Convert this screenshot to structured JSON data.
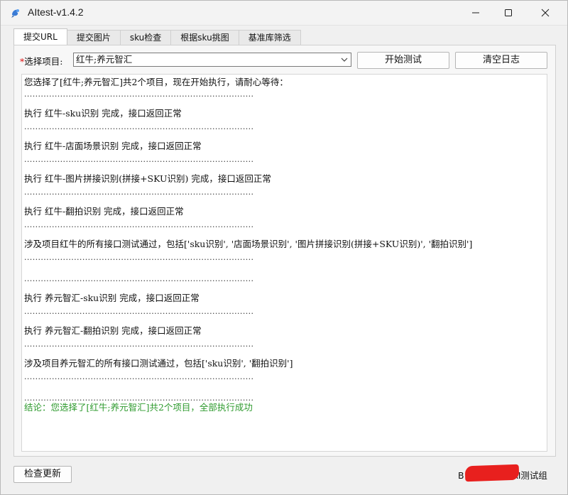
{
  "window": {
    "title": "AItest-v1.4.2",
    "minimize_icon": "minimize-icon",
    "maximize_icon": "maximize-icon",
    "close_icon": "close-icon"
  },
  "tabs": [
    {
      "label": "提交URL",
      "active": true
    },
    {
      "label": "提交图片",
      "active": false
    },
    {
      "label": "sku检查",
      "active": false
    },
    {
      "label": "根据sku挑图",
      "active": false
    },
    {
      "label": "基准库筛选",
      "active": false
    }
  ],
  "project": {
    "required_mark": "*",
    "label": "选择项目:",
    "selected": "红牛;养元智汇"
  },
  "buttons": {
    "start": "开始测试",
    "clear": "清空日志",
    "update": "检查更新"
  },
  "log": [
    {
      "text": "您选择了[红牛;养元智汇]共2个项目，现在开始执行，请耐心等待：",
      "type": "normal"
    },
    {
      "text": "...................................................................................",
      "type": "dots"
    },
    {
      "text": "执行 红牛-sku识别 完成，接口返回正常",
      "type": "normal"
    },
    {
      "text": "...................................................................................",
      "type": "dots"
    },
    {
      "text": "执行 红牛-店面场景识别 完成，接口返回正常",
      "type": "normal"
    },
    {
      "text": "...................................................................................",
      "type": "dots"
    },
    {
      "text": "执行 红牛-图片拼接识别(拼接+SKU识别) 完成，接口返回正常",
      "type": "normal"
    },
    {
      "text": "...................................................................................",
      "type": "dots"
    },
    {
      "text": "执行 红牛-翻拍识别 完成，接口返回正常",
      "type": "normal"
    },
    {
      "text": "...................................................................................",
      "type": "dots"
    },
    {
      "text": "涉及项目红牛的所有接口测试通过，包括['sku识别', '店面场景识别', '图片拼接识别(拼接+SKU识别)', '翻拍识别']",
      "type": "normal"
    },
    {
      "text": "...................................................................................",
      "type": "dots"
    },
    {
      "text": "...................................................................................",
      "type": "dots"
    },
    {
      "text": "执行 养元智汇-sku识别 完成，接口返回正常",
      "type": "normal"
    },
    {
      "text": "...................................................................................",
      "type": "dots"
    },
    {
      "text": "执行 养元智汇-翻拍识别 完成，接口返回正常",
      "type": "normal"
    },
    {
      "text": "...................................................................................",
      "type": "dots"
    },
    {
      "text": "涉及项目养元智汇的所有接口测试通过，包括['sku识别', '翻拍识别']",
      "type": "normal"
    },
    {
      "text": "...................................................................................",
      "type": "dots"
    },
    {
      "text": "...................................................................................",
      "type": "dots"
    },
    {
      "text": "结论：您选择了[红牛;养元智汇]共2个项目，全部执行成功",
      "type": "green"
    }
  ],
  "footer": {
    "prefix": "B",
    "suffix": "AI测试组"
  },
  "colors": {
    "success": "#2e9a2e",
    "required": "#dd1111",
    "redaction": "#e8201e"
  }
}
